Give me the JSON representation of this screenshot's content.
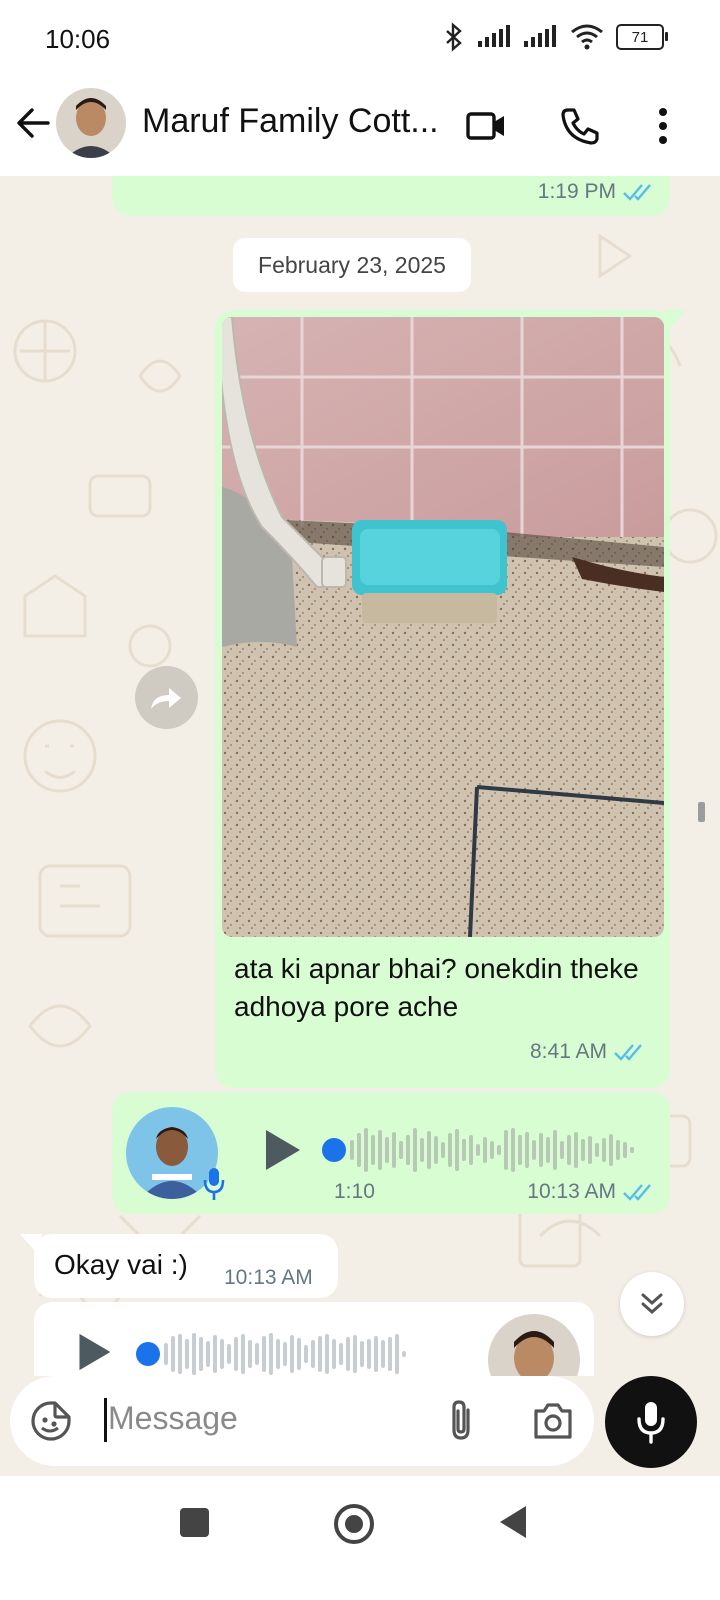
{
  "status_bar": {
    "time": "10:06",
    "battery": "71",
    "icons": [
      "bluetooth-icon",
      "signal-icon",
      "signal-icon",
      "wifi-icon",
      "battery-icon"
    ]
  },
  "header": {
    "title": "Maruf Family Cott...",
    "icons": [
      "back-arrow-icon",
      "video-call-icon",
      "phone-icon",
      "more-vertical-icon"
    ]
  },
  "colors": {
    "outgoing_bubble": "#d9fdd3",
    "incoming_bubble": "#ffffff",
    "read_ticks": "#53bdeb",
    "voice_dot": "#1a73e8",
    "chat_background": "#f4efe6"
  },
  "messages": {
    "top_partial": {
      "time": "1:19 PM",
      "status": "read"
    },
    "date_separator": "February 23, 2025",
    "photo_message": {
      "caption": "ata ki apnar bhai? onekdin theke adhoya pore ache",
      "time": "8:41 AM",
      "status": "read"
    },
    "voice_outgoing": {
      "duration": "1:10",
      "time": "10:13 AM",
      "status": "read"
    },
    "incoming_text": {
      "text": "Okay vai :)",
      "time": "10:13 AM"
    }
  },
  "composer": {
    "placeholder": "Message",
    "icons": [
      "sticker-icon",
      "attach-icon",
      "camera-icon",
      "mic-icon"
    ]
  },
  "nav_bar": {
    "icons": [
      "recents-square-icon",
      "home-circle-icon",
      "back-triangle-icon"
    ]
  }
}
